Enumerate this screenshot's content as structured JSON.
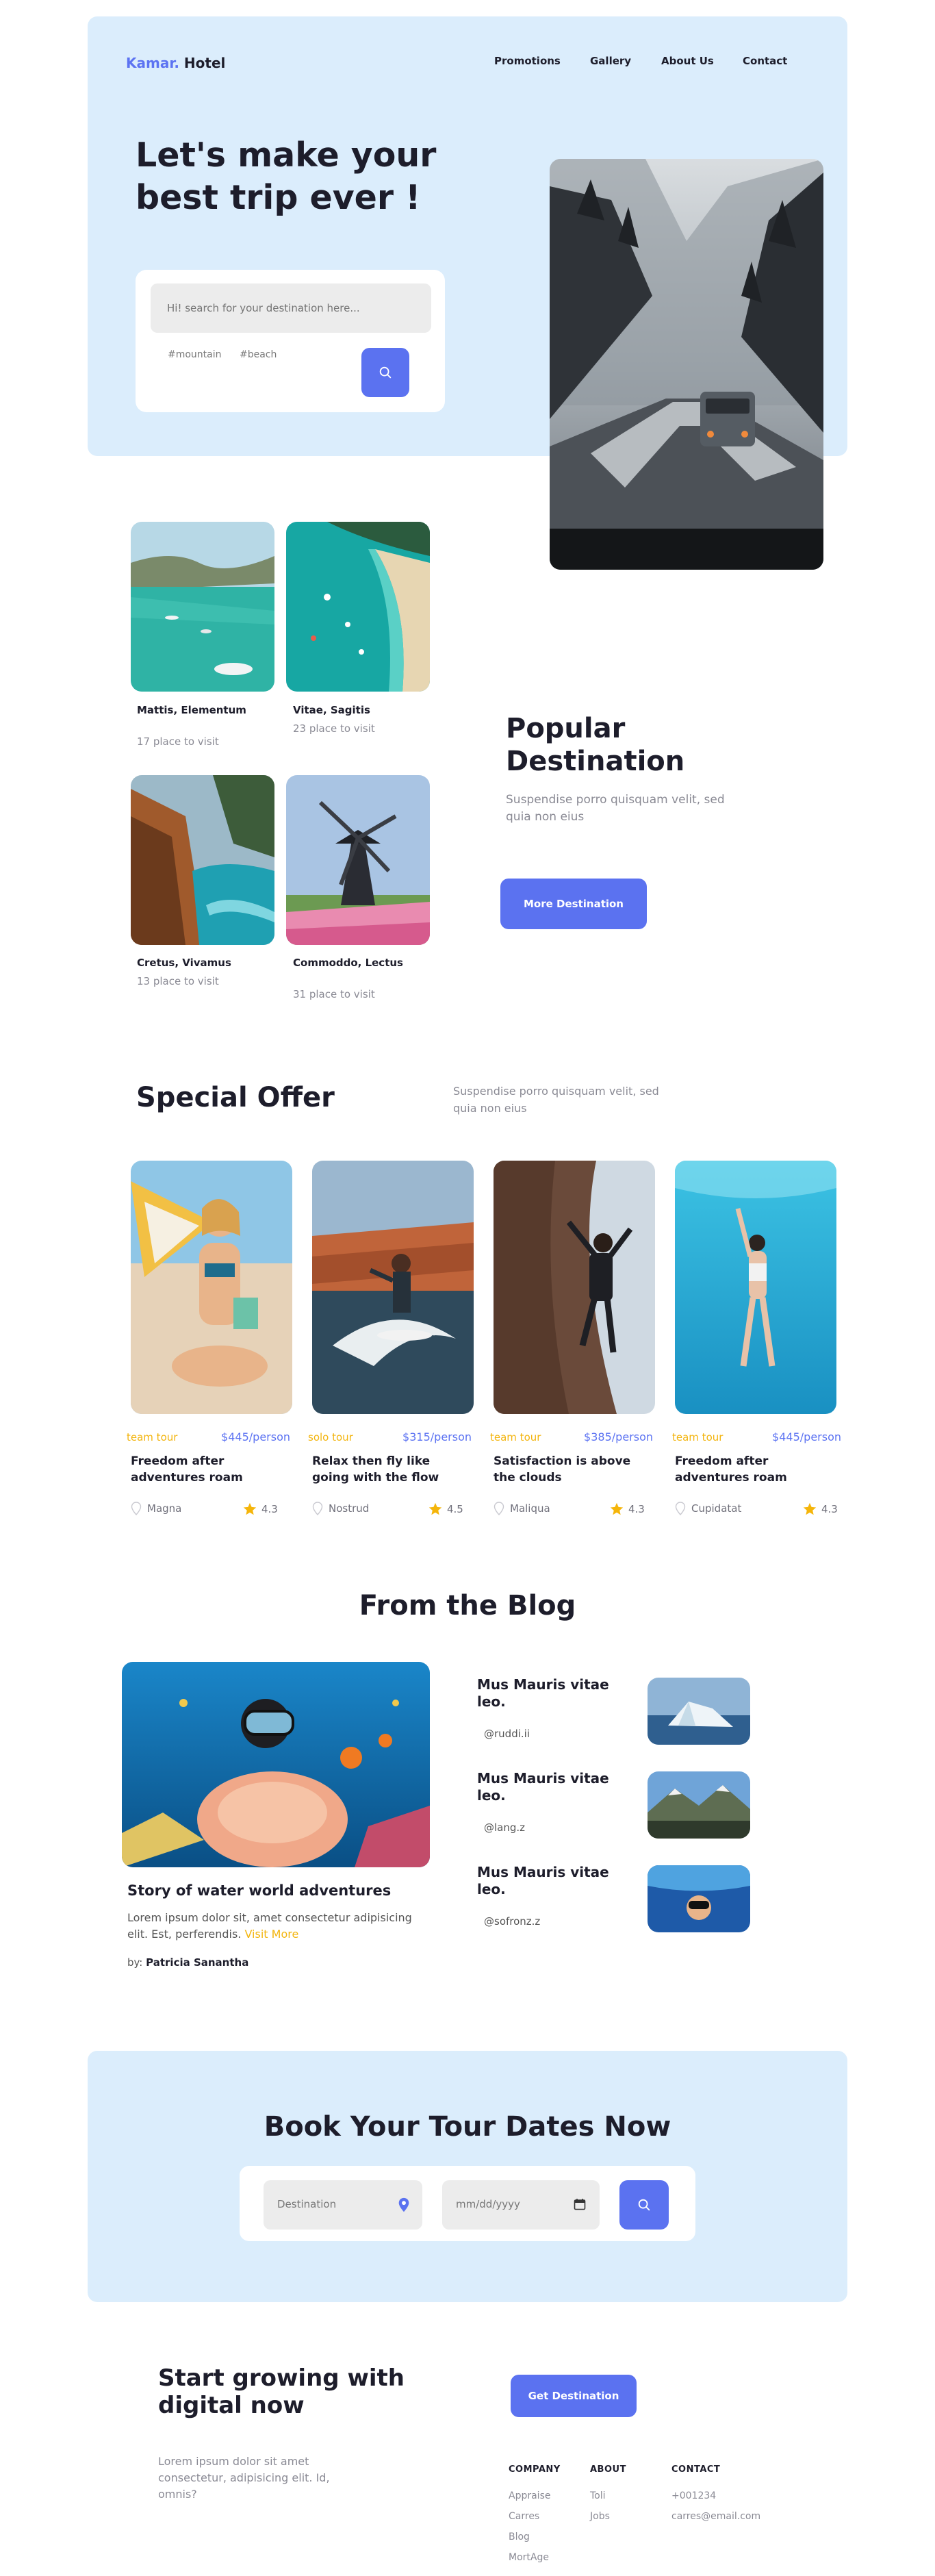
{
  "brand": {
    "accent": "Kamar.",
    "name": " Hotel"
  },
  "nav": {
    "items": [
      "Promotions",
      "Gallery",
      "About Us",
      "Contact"
    ]
  },
  "hero": {
    "title": "Let's make your best trip ever !",
    "search_placeholder": "Hi! search for your destination here...",
    "tags": [
      "#mountain",
      "#beach"
    ]
  },
  "destinations": [
    {
      "name": "Mattis, Elementum",
      "sub": "17 place to visit"
    },
    {
      "name": "Vitae, Sagitis",
      "sub": "23 place to visit"
    },
    {
      "name": "Cretus, Vivamus",
      "sub": "13 place to visit"
    },
    {
      "name": "Commoddo, Lectus",
      "sub": "31 place to visit"
    }
  ],
  "popular": {
    "title": "Popular Destination",
    "text": "Suspendise porro quisquam velit, sed quia non eius",
    "button": "More Destination"
  },
  "special": {
    "title": "Special Offer",
    "text": "Suspendise porro quisquam velit, sed quia non eius",
    "offers": [
      {
        "type": "team tour",
        "price": "$445",
        "unit": "/person",
        "title": "Freedom after adventures roam",
        "location": "Magna",
        "rating": "4.3"
      },
      {
        "type": "solo tour",
        "price": "$315",
        "unit": "/person",
        "title": "Relax then fly like going with the flow",
        "location": "Nostrud",
        "rating": "4.5"
      },
      {
        "type": "team tour",
        "price": "$385",
        "unit": "/person",
        "title": "Satisfaction is above the clouds",
        "location": "Maliqua",
        "rating": "4.3"
      },
      {
        "type": "team tour",
        "price": "$445",
        "unit": "/person",
        "title": "Freedom after adventures roam",
        "location": "Cupidatat",
        "rating": "4.3"
      }
    ]
  },
  "blog": {
    "title": "From the Blog",
    "main": {
      "title": "Story of water world adventures",
      "text": "Lorem ipsum dolor sit, amet consectetur adipisicing elit. Est, perferendis.",
      "link": "Visit More",
      "by_label": "by:",
      "author": "Patricia Sanantha"
    },
    "side": [
      {
        "title": "Mus Mauris vitae leo.",
        "handle": "@ruddi.ii"
      },
      {
        "title": "Mus Mauris vitae leo.",
        "handle": "@lang.z"
      },
      {
        "title": "Mus Mauris vitae leo.",
        "handle": "@sofronz.z"
      }
    ]
  },
  "book": {
    "title": "Book Your Tour Dates Now",
    "destination_placeholder": "Destination",
    "date_placeholder": "mm/dd/yyyy"
  },
  "footer": {
    "title": "Start growing with digital now",
    "button": "Get Destination",
    "text": "Lorem ipsum dolor sit amet consectetur, adipisicing elit. Id, omnis?",
    "columns": [
      {
        "head": "COMPANY",
        "items": [
          "Appraise",
          "Carres",
          "Blog",
          "MortAge"
        ]
      },
      {
        "head": "ABOUT",
        "items": [
          "Toli",
          "Jobs"
        ]
      },
      {
        "head": "CONTACT",
        "items": [
          "+001234",
          "carres@email.com"
        ]
      }
    ]
  },
  "colors": {
    "accent": "#5b72f0",
    "hero_bg": "#dbedfc",
    "tour": "#f3b50f",
    "star": "#f5b50a"
  }
}
